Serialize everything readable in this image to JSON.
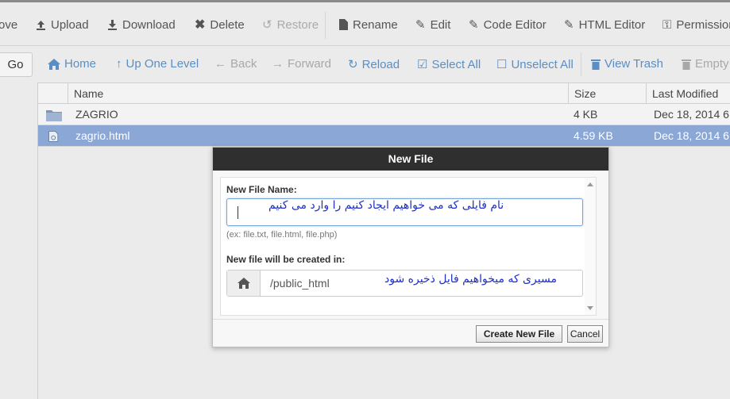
{
  "toolbar": {
    "items": [
      {
        "label": "ove",
        "icon": "move-icon"
      },
      {
        "label": "Upload",
        "icon": "upload-icon"
      },
      {
        "label": "Download",
        "icon": "download-icon"
      },
      {
        "label": "Delete",
        "icon": "delete-icon"
      },
      {
        "label": "Restore",
        "icon": "restore-icon",
        "disabled": true
      },
      {
        "label": "Rename",
        "icon": "rename-icon"
      },
      {
        "label": "Edit",
        "icon": "edit-icon"
      },
      {
        "label": "Code Editor",
        "icon": "code-editor-icon"
      },
      {
        "label": "HTML Editor",
        "icon": "html-editor-icon"
      },
      {
        "label": "Permission",
        "icon": "permissions-icon"
      }
    ]
  },
  "nav": {
    "go_label": "Go",
    "items": [
      {
        "label": "Home",
        "icon": "home-icon"
      },
      {
        "label": "Up One Level",
        "icon": "up-arrow-icon"
      },
      {
        "label": "Back",
        "icon": "back-arrow-icon",
        "disabled": true
      },
      {
        "label": "Forward",
        "icon": "forward-arrow-icon",
        "disabled": true
      },
      {
        "label": "Reload",
        "icon": "reload-icon"
      },
      {
        "label": "Select All",
        "icon": "checkbox-checked-icon"
      },
      {
        "label": "Unselect All",
        "icon": "checkbox-empty-icon"
      },
      {
        "label": "View Trash",
        "icon": "trash-icon"
      },
      {
        "label": "Empty",
        "icon": "trash-icon",
        "disabled": true
      }
    ]
  },
  "table": {
    "columns": [
      "Name",
      "Size",
      "Last Modified"
    ],
    "rows": [
      {
        "name": "ZAGRIO",
        "size": "4 KB",
        "modified": "Dec 18, 2014 6",
        "type": "folder",
        "selected": false
      },
      {
        "name": "zagrio.html",
        "size": "4.59 KB",
        "modified": "Dec 18, 2014 6",
        "type": "html-file",
        "selected": true
      }
    ]
  },
  "dialog": {
    "title": "New File",
    "file_name_label": "New File Name:",
    "file_name_value": "",
    "file_name_annotation": "نام فایلی که می خواهیم ایجاد کنیم را وارد می کنیم",
    "file_name_hint": "(ex: file.txt, file.html, file.php)",
    "path_label": "New file will be created in:",
    "path_value": "/public_html",
    "path_annotation": "مسیری که میخواهیم فایل ذخیره شود",
    "create_button": "Create New File",
    "cancel_button": "Cancel"
  },
  "colors": {
    "selected_row": "#8aa7d6",
    "link_blue": "#5a8ec5",
    "dialog_header": "#2f2f2f",
    "annotation_blue": "#1c2fc9"
  }
}
